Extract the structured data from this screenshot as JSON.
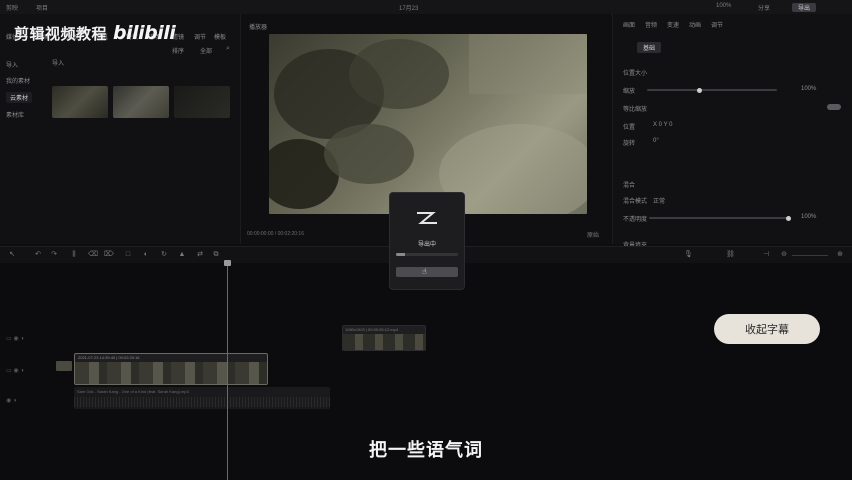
{
  "watermark": {
    "text": "剪辑视频教程",
    "logo": "bilibili"
  },
  "topbar": {
    "menu": "剪映",
    "project": "项目",
    "title": "17月23",
    "zoom": "100%",
    "share": "分享",
    "export": "导出"
  },
  "media_panel": {
    "tabs": [
      "媒体",
      "音频",
      "文本",
      "贴纸",
      "特效",
      "转场",
      "滤镜",
      "调节",
      "模板"
    ],
    "sidebar": [
      "导入",
      "我的素材",
      "云素材",
      "素材库"
    ],
    "active_sidebar": 2,
    "tool_row": [
      "导入",
      "排序",
      "全部"
    ]
  },
  "player": {
    "title": "播放器",
    "time": "00:00:00:00 / 00:02:20:16",
    "ratio": "原始"
  },
  "inspector": {
    "tabs": [
      "画面",
      "音频",
      "变速",
      "动画",
      "调节"
    ],
    "section1": "基础",
    "rows": [
      {
        "label": "混合",
        "value": "100%"
      },
      {
        "label": "位置大小",
        "value": ""
      },
      {
        "label": "缩放",
        "value": "100%"
      },
      {
        "label": "等比缩放",
        "value": ""
      },
      {
        "label": "位置",
        "value": "X 0   Y 0"
      },
      {
        "label": "旋转",
        "value": "0°"
      }
    ],
    "section2": "混合",
    "blend_mode_label": "混合模式",
    "blend_mode": "正常",
    "opacity_label": "不透明度",
    "opacity": "100%",
    "background_label": "背景填充",
    "scale_level": 0.4,
    "opacity_level": 1.0
  },
  "dialog": {
    "title": "导出中",
    "progress": 0.15
  },
  "timeline": {
    "clip_label": "2021-07-23 14:39:40 | 00:02:20:16",
    "overlay_clip_label": "1080x1920 | 00:00:05:12.mp4",
    "audio_label": "Sam Ock - Sarah Kang - One of a Kind (feat. Sarah Kang).mp3"
  },
  "pill": {
    "text": "收起字幕"
  },
  "subtitle": "把一些语气词",
  "colors": {
    "bg": "#0e0e10",
    "panel": "#111114",
    "accent": "#e7e3da"
  }
}
